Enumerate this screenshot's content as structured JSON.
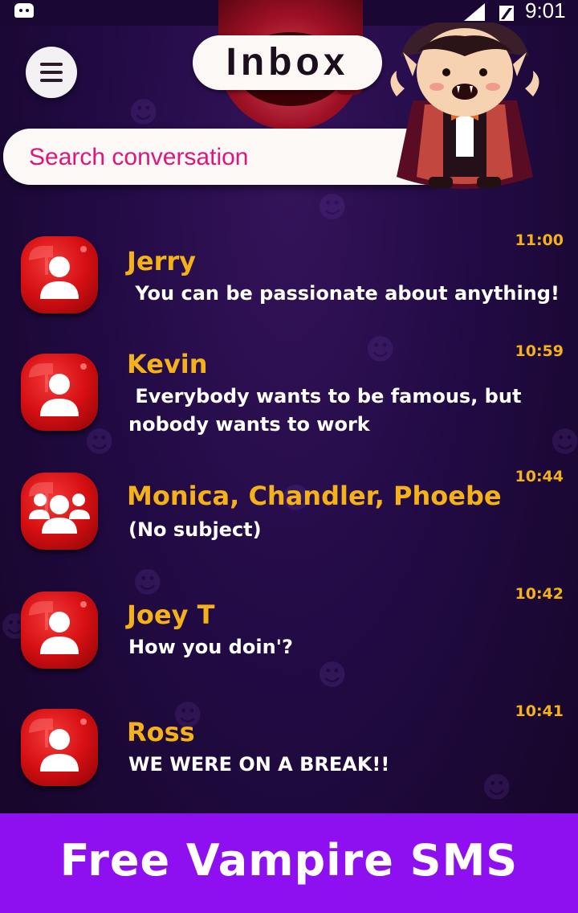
{
  "status_bar": {
    "time": "9:01",
    "icons": [
      "app-notification-icon",
      "signal-icon",
      "battery-icon"
    ]
  },
  "header": {
    "title": "Inbox",
    "menu_icon": "hamburger-menu-icon",
    "mascot": "vampire-character"
  },
  "search": {
    "placeholder": "Search conversation",
    "value": ""
  },
  "conversations": [
    {
      "name": "Jerry",
      "message": " You can be passionate about anything!",
      "time": "11:00",
      "avatar": "single-person-icon"
    },
    {
      "name": "Kevin",
      "message": " Everybody wants to be famous, but\nnobody wants to work",
      "time": "10:59",
      "avatar": "single-person-icon"
    },
    {
      "name": "Monica, Chandler, Phoebe",
      "message": "(No subject)",
      "time": "10:44",
      "avatar": "group-people-icon"
    },
    {
      "name": "Joey T",
      "message": "How you doin'?",
      "time": "10:42",
      "avatar": "single-person-icon"
    },
    {
      "name": "Ross",
      "message": "WE WERE ON A BREAK!!",
      "time": "10:41",
      "avatar": "single-person-icon"
    }
  ],
  "banner": {
    "text": "Free Vampire SMS"
  },
  "colors": {
    "name": "#f5b119",
    "time": "#f5b119",
    "message": "#ffffff",
    "search_text": "#e0157a",
    "banner": "#8e0ff0",
    "background": "#220b45",
    "avatar": "#d60f12"
  }
}
